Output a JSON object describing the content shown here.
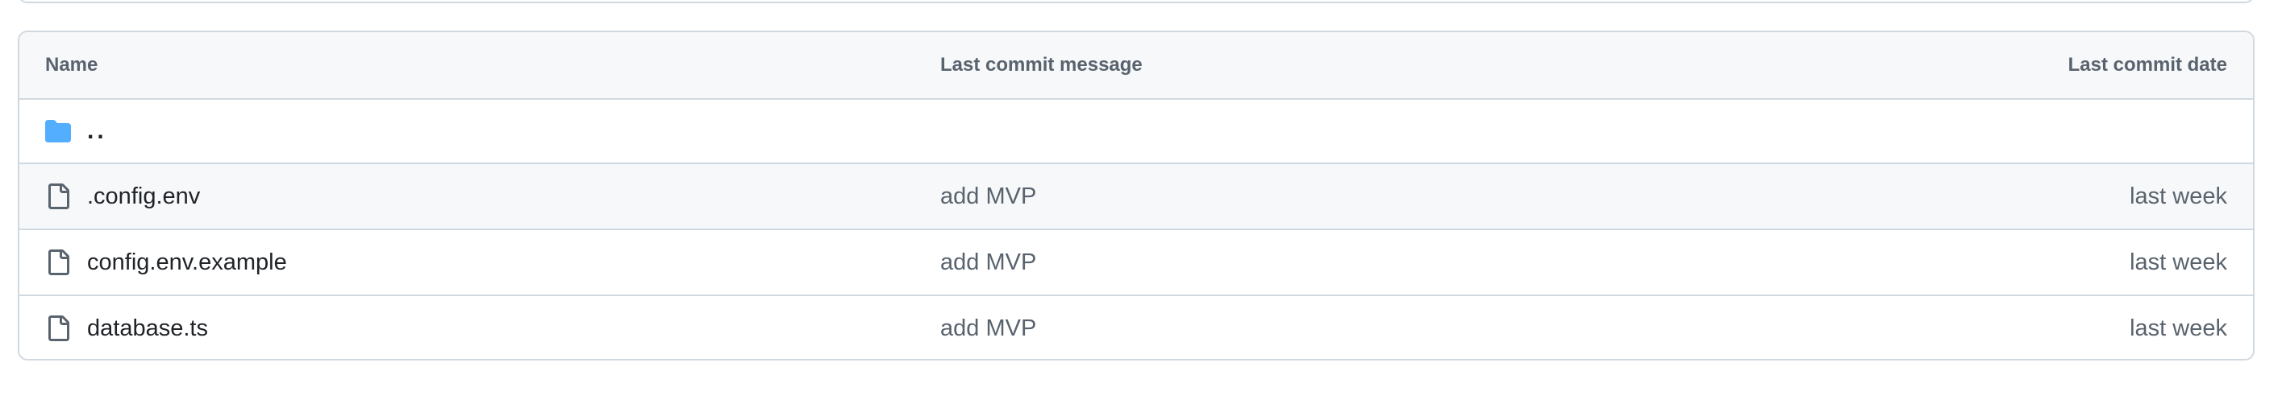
{
  "table": {
    "headers": {
      "name": "Name",
      "message": "Last commit message",
      "date": "Last commit date"
    },
    "parent_dir": {
      "label": "..",
      "icon": "folder-icon",
      "icon_color": "#54aeff"
    },
    "rows": [
      {
        "name": ".config.env",
        "icon": "file-icon",
        "message": "add MVP",
        "date": "last week"
      },
      {
        "name": "config.env.example",
        "icon": "file-icon",
        "message": "add MVP",
        "date": "last week"
      },
      {
        "name": "database.ts",
        "icon": "file-icon",
        "message": "add MVP",
        "date": "last week"
      }
    ]
  },
  "colors": {
    "border": "#d1d9e0",
    "header_bg": "#f6f8fa",
    "muted_text": "#59636e",
    "primary_text": "#1f2328",
    "folder": "#54aeff"
  }
}
